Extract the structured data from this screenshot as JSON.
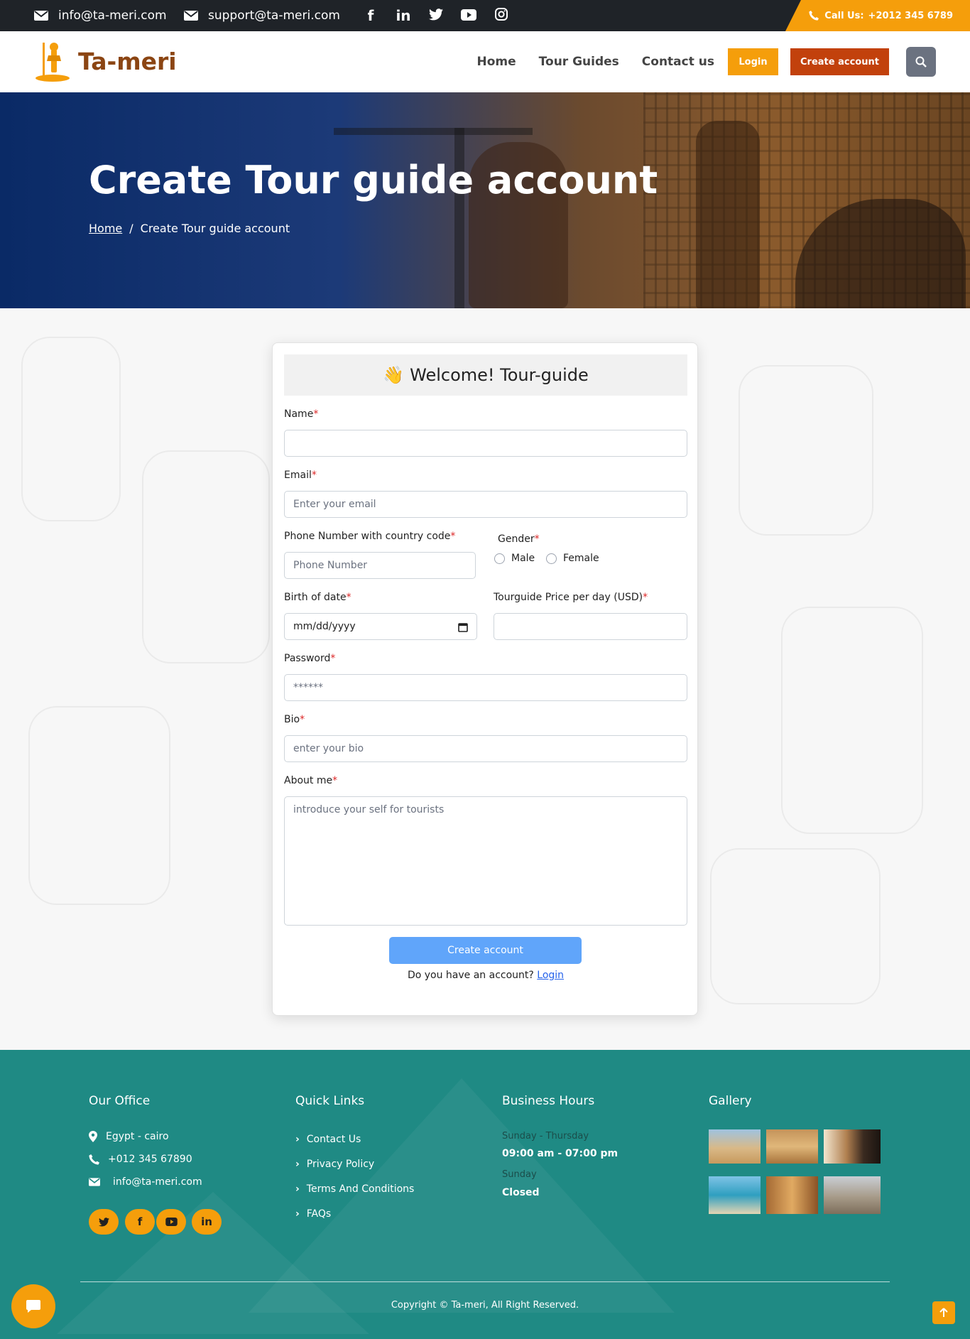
{
  "topbar": {
    "email1": "info@ta-meri.com",
    "email2": "support@ta-meri.com",
    "social": [
      "f",
      "in",
      "tw",
      "yt",
      "ig"
    ],
    "call_label": "Call Us:",
    "call_number": "+2012 345 6789"
  },
  "nav": {
    "logo": "Ta-meri",
    "links": [
      "Home",
      "Tour Guides",
      "Contact us"
    ],
    "login": "Login",
    "create": "Create account"
  },
  "hero": {
    "title": "Create Tour guide account",
    "crumb_home": "Home",
    "crumb_sep": "/",
    "crumb_current": "Create Tour guide account"
  },
  "form": {
    "title_emoji": "👋",
    "title": "Welcome! Tour-guide",
    "name_label": "Name",
    "email_label": "Email",
    "email_placeholder": "Enter your email",
    "phone_label": "Phone Number with country code",
    "phone_placeholder": "Phone Number",
    "gender_label": "Gender",
    "gender_male": "Male",
    "gender_female": "Female",
    "dob_label": "Birth of date",
    "dob_placeholder": "mm/dd/yyyy",
    "price_label": "Tourguide Price per day (USD)",
    "password_label": "Password",
    "password_value": "******",
    "bio_label": "Bio",
    "bio_placeholder": "enter your bio",
    "about_label": "About me",
    "about_placeholder": "introduce your self for tourists",
    "required_mark": "*",
    "submit": "Create account",
    "have_account": "Do you have an account?",
    "login_link": "Login"
  },
  "footer": {
    "office_title": "Our Office",
    "address": "Egypt - cairo",
    "phone": "+012 345 67890",
    "email": "info@ta-meri.com",
    "social": [
      "tw",
      "f",
      "yt",
      "in"
    ],
    "links_title": "Quick Links",
    "links": [
      "Contact Us",
      "Privacy Policy",
      "Terms And Conditions",
      "FAQs"
    ],
    "hours_title": "Business Hours",
    "days1": "Sunday - Thursday",
    "hours1": "09:00 am - 07:00 pm",
    "days2": "Sunday",
    "hours2": "Closed",
    "gallery_title": "Gallery",
    "copyright": "Copyright © Ta-meri, All Right Reserved."
  },
  "colors": {
    "accent": "#f59e0b",
    "brand": "#c2410c",
    "footer": "#1f8a84",
    "topbar": "#1f2328"
  }
}
